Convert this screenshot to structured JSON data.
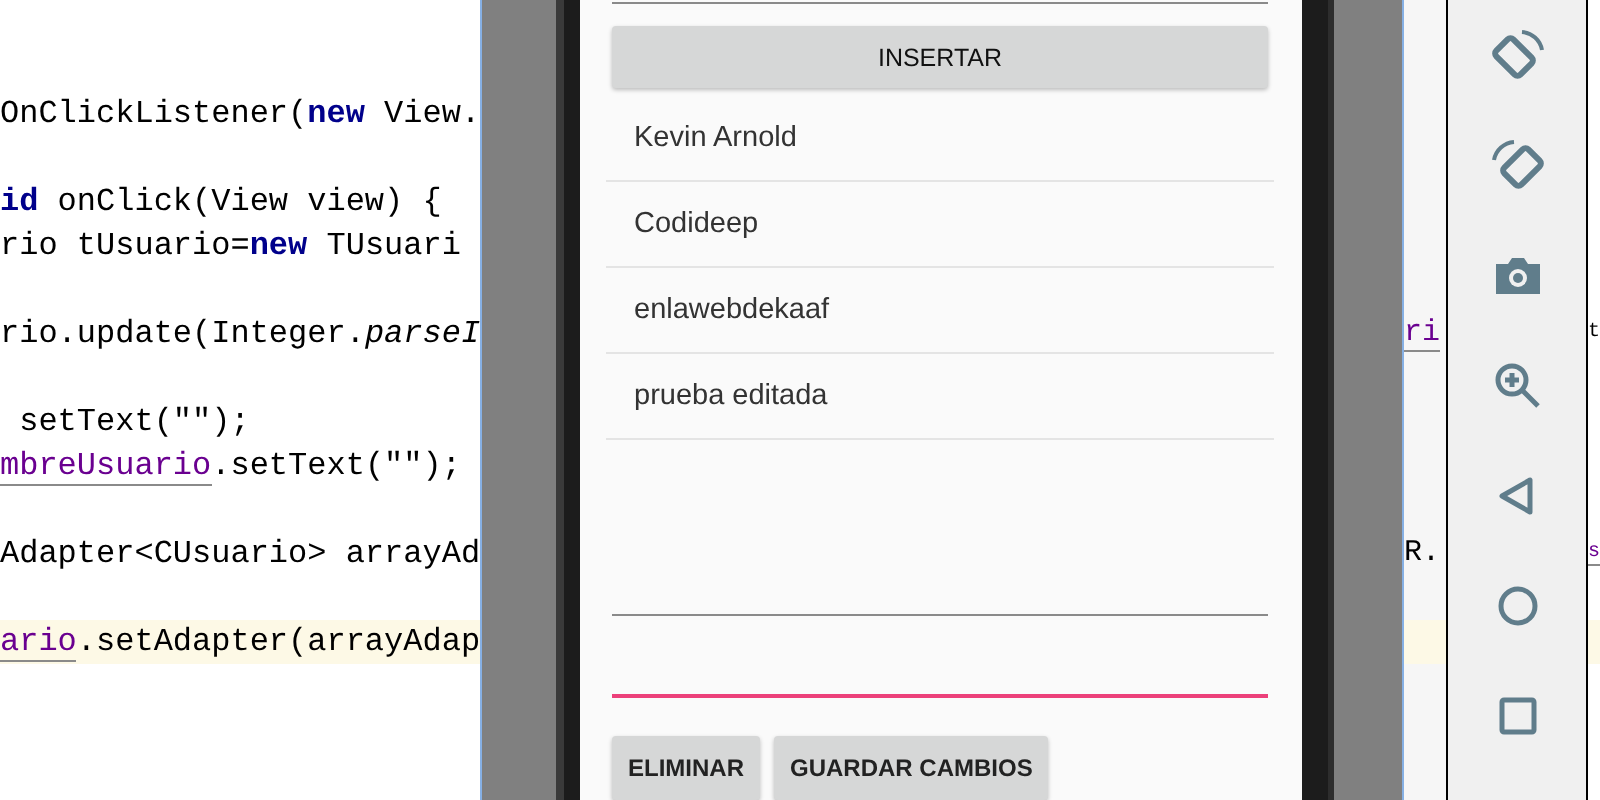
{
  "editor": {
    "lines": [
      {
        "highlighted": false,
        "segments": [
          {
            "kind": "plain",
            "text": "OnClickListener("
          },
          {
            "kind": "keyword",
            "text": "new"
          },
          {
            "kind": "plain",
            "text": " View."
          }
        ]
      },
      {
        "highlighted": false,
        "segments": [
          {
            "kind": "keyword",
            "text": "id"
          },
          {
            "kind": "plain",
            "text": " onClick(View view) {"
          }
        ]
      },
      {
        "highlighted": false,
        "segments": [
          {
            "kind": "plain",
            "text": "rio tUsuario="
          },
          {
            "kind": "keyword",
            "text": "new"
          },
          {
            "kind": "plain",
            "text": " TUsuari"
          }
        ]
      },
      {
        "highlighted": false,
        "segments": [
          {
            "kind": "plain",
            "text": "rio.update(Integer."
          },
          {
            "kind": "static",
            "text": "parseI"
          }
        ]
      },
      {
        "highlighted": false,
        "segments": [
          {
            "kind": "plain",
            "text": " setText(\"\");"
          }
        ]
      },
      {
        "highlighted": false,
        "segments": [
          {
            "kind": "field",
            "text": "mbreUsuario"
          },
          {
            "kind": "plain",
            "text": ".setText(\"\");"
          }
        ]
      },
      {
        "highlighted": false,
        "segments": [
          {
            "kind": "plain",
            "text": "Adapter<CUsuario> arrayAd"
          }
        ]
      },
      {
        "highlighted": true,
        "segments": [
          {
            "kind": "field",
            "text": "ario"
          },
          {
            "kind": "plain",
            "text": ".setAdapter(arrayAdap"
          }
        ]
      }
    ],
    "strip_left": [
      {
        "kind": "field",
        "text": "ri"
      },
      {
        "kind": "plain",
        "text": "R."
      }
    ],
    "strip_right": [
      {
        "kind": "plain",
        "text": "t"
      },
      {
        "kind": "field",
        "text": "s"
      }
    ]
  },
  "app": {
    "top_field": {
      "focused": false
    },
    "insert_button": "INSERTAR",
    "users": [
      "Kevin Arnold",
      "Codideep",
      "enlawebdekaaf",
      "prueba editada"
    ],
    "fields": [
      {
        "focused": false
      },
      {
        "focused": true
      }
    ],
    "buttons": [
      "ELIMINAR",
      "GUARDAR CAMBIOS"
    ]
  },
  "emulator_toolbar": [
    {
      "kind": "rotate-left"
    },
    {
      "kind": "rotate-right"
    },
    {
      "kind": "camera"
    },
    {
      "kind": "zoom"
    },
    {
      "kind": "back"
    },
    {
      "kind": "home"
    },
    {
      "kind": "overview"
    }
  ]
}
